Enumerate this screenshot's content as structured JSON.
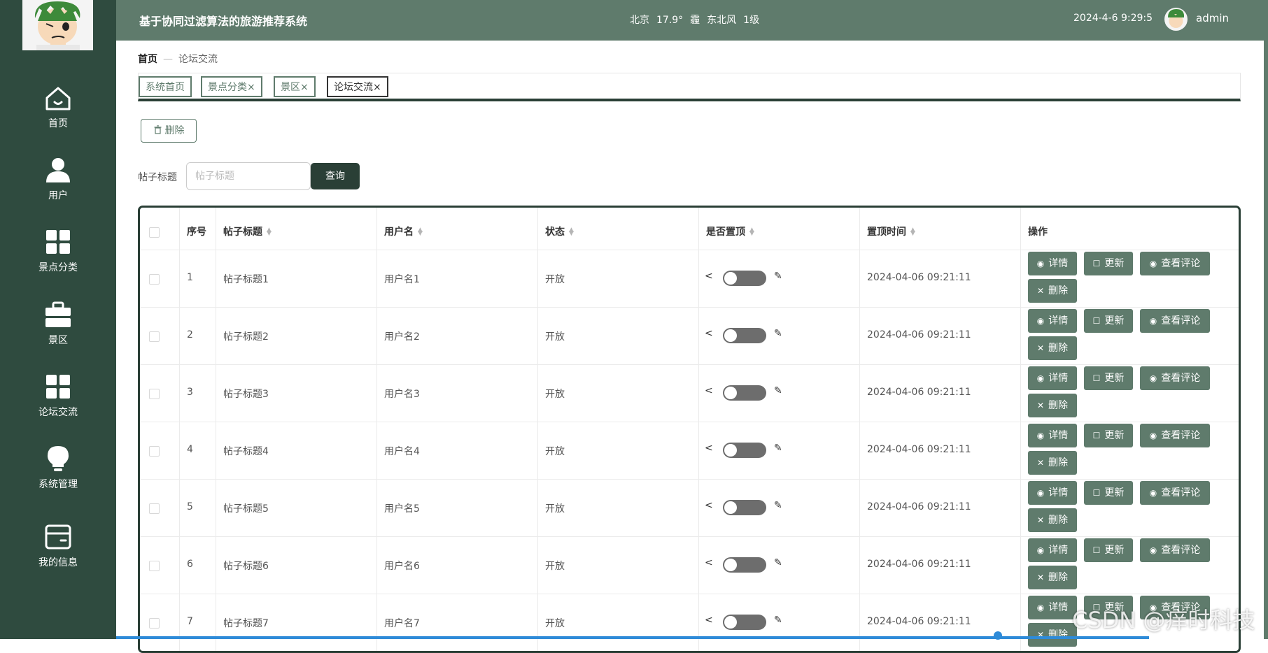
{
  "app_title": "基于协同过滤算法的旅游推荐系统",
  "weather": {
    "city": "北京",
    "temperature": "17.9°",
    "condition": "霾",
    "wind": "东北风",
    "wind_level": "1级"
  },
  "datetime": "2024-4-6 9:29:5",
  "user": {
    "name": "admin"
  },
  "sidebar": {
    "items": [
      {
        "label": "首页",
        "icon": "home-icon"
      },
      {
        "label": "用户",
        "icon": "user-icon"
      },
      {
        "label": "景点分类",
        "icon": "grid-icon"
      },
      {
        "label": "景区",
        "icon": "briefcase-icon"
      },
      {
        "label": "论坛交流",
        "icon": "grid-icon"
      },
      {
        "label": "系统管理",
        "icon": "lightbulb-icon"
      },
      {
        "label": "我的信息",
        "icon": "wallet-icon"
      }
    ]
  },
  "breadcrumb": {
    "home": "首页",
    "separator": "—",
    "current": "论坛交流"
  },
  "tabs": [
    {
      "label": "系统首页",
      "closable": false
    },
    {
      "label": "景点分类",
      "closable": true
    },
    {
      "label": "景区",
      "closable": true
    },
    {
      "label": "论坛交流",
      "closable": true,
      "active": true
    }
  ],
  "tab_close_glyph": "×",
  "toolbar": {
    "delete_label": "删除"
  },
  "search": {
    "label": "帖子标题",
    "placeholder": "帖子标题",
    "value": "",
    "button": "查询"
  },
  "table": {
    "columns": [
      "序号",
      "帖子标题",
      "用户名",
      "状态",
      "是否置顶",
      "置顶时间",
      "操作"
    ],
    "rows": [
      {
        "index": "1",
        "title": "帖子标题1",
        "username": "用户名1",
        "status": "开放",
        "pinned": false,
        "time": "2024-04-06 09:21:11"
      },
      {
        "index": "2",
        "title": "帖子标题2",
        "username": "用户名2",
        "status": "开放",
        "pinned": false,
        "time": "2024-04-06 09:21:11"
      },
      {
        "index": "3",
        "title": "帖子标题3",
        "username": "用户名3",
        "status": "开放",
        "pinned": false,
        "time": "2024-04-06 09:21:11"
      },
      {
        "index": "4",
        "title": "帖子标题4",
        "username": "用户名4",
        "status": "开放",
        "pinned": false,
        "time": "2024-04-06 09:21:11"
      },
      {
        "index": "5",
        "title": "帖子标题5",
        "username": "用户名5",
        "status": "开放",
        "pinned": false,
        "time": "2024-04-06 09:21:11"
      },
      {
        "index": "6",
        "title": "帖子标题6",
        "username": "用户名6",
        "status": "开放",
        "pinned": false,
        "time": "2024-04-06 09:21:11"
      },
      {
        "index": "7",
        "title": "帖子标题7",
        "username": "用户名7",
        "status": "开放",
        "pinned": false,
        "time": "2024-04-06 09:21:11"
      }
    ],
    "row_actions": {
      "detail": "详情",
      "update": "更新",
      "comments": "查看评论",
      "delete": "删除"
    },
    "switch_left_glyph": "<",
    "switch_right_glyph": "✎"
  },
  "watermark": "CSDN @痒时科技",
  "colors": {
    "sidebar": "#2f4b3f",
    "topbar": "#5f7b6c",
    "accent": "#2a3f36",
    "action_button": "#5f7b6c"
  }
}
